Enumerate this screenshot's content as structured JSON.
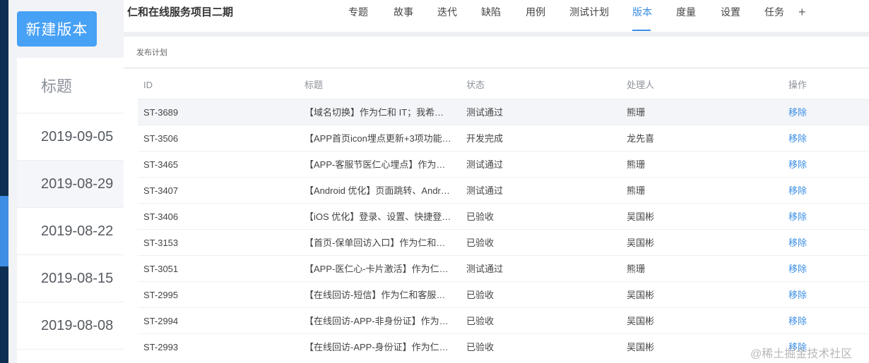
{
  "sidebar": {
    "new_button_label": "新建版本",
    "list_title": "标题",
    "versions": [
      "2019-09-05",
      "2019-08-29",
      "2019-08-22",
      "2019-08-15",
      "2019-08-08"
    ]
  },
  "header": {
    "project_title": "仁和在线服务项目二期",
    "nav": [
      "专题",
      "故事",
      "迭代",
      "缺陷",
      "用例",
      "测试计划",
      "版本",
      "度量",
      "设置",
      "任务"
    ],
    "active_nav": "版本",
    "add_symbol": "+"
  },
  "main": {
    "section_label": "发布计划",
    "columns": [
      "ID",
      "标题",
      "状态",
      "处理人",
      "操作"
    ],
    "rows": [
      {
        "id": "ST-3689",
        "title": "【域名切换】作为仁和 IT；我希望…",
        "status": "测试通过",
        "owner": "熊珊",
        "op": "移除"
      },
      {
        "id": "ST-3506",
        "title": "【APP首页icon埋点更新+3项功能…",
        "status": "开发完成",
        "owner": "龙先喜",
        "op": "移除"
      },
      {
        "id": "ST-3465",
        "title": "【APP-客服节医仁心埋点】作为仁…",
        "status": "测试通过",
        "owner": "熊珊",
        "op": "移除"
      },
      {
        "id": "ST-3407",
        "title": "【Android 优化】页面跳转、Androi…",
        "status": "测试通过",
        "owner": "熊珊",
        "op": "移除"
      },
      {
        "id": "ST-3406",
        "title": "【iOS 优化】登录、设置、快捷登…",
        "status": "已验收",
        "owner": "吴国彬",
        "op": "移除"
      },
      {
        "id": "ST-3153",
        "title": "【首页-保单回访入口】作为仁和客…",
        "status": "已验收",
        "owner": "吴国彬",
        "op": "移除"
      },
      {
        "id": "ST-3051",
        "title": "【APP-医仁心-卡片激活】作为仁和…",
        "status": "测试通过",
        "owner": "熊珊",
        "op": "移除"
      },
      {
        "id": "ST-2995",
        "title": "【在线回访-短信】作为仁和客服；…",
        "status": "已验收",
        "owner": "吴国彬",
        "op": "移除"
      },
      {
        "id": "ST-2994",
        "title": "【在线回访-APP-非身份证】作为仁…",
        "status": "已验收",
        "owner": "吴国彬",
        "op": "移除"
      },
      {
        "id": "ST-2993",
        "title": "【在线回访-APP-身份证】作为仁和…",
        "status": "已验收",
        "owner": "吴国彬",
        "op": "移除"
      }
    ]
  },
  "watermark": "@稀土掘金技术社区",
  "colors": {
    "accent": "#3a8ee6",
    "button": "#47a1f5",
    "sidebar_dark": "#0f2f52"
  }
}
